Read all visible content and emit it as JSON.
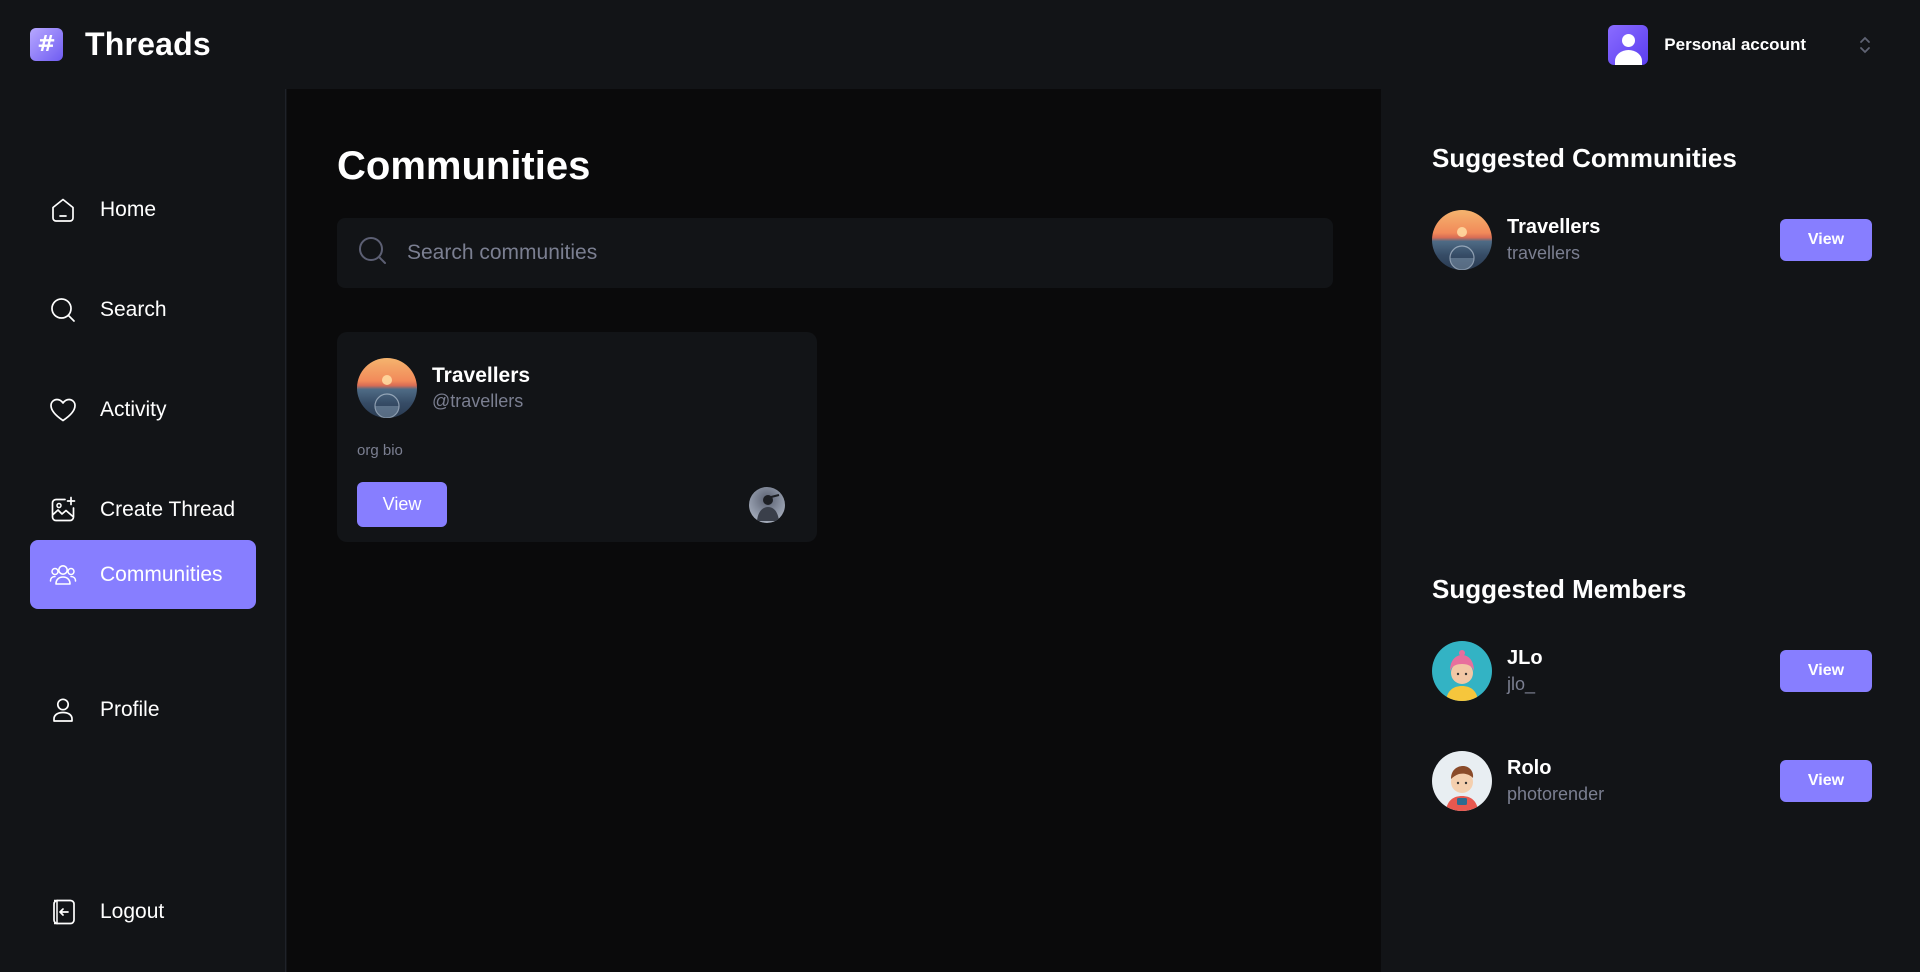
{
  "topbar": {
    "logo_glyph": "#",
    "brand": "Threads",
    "account_label": "Personal account"
  },
  "sidebar": {
    "items": [
      {
        "label": "Home",
        "icon": "home-icon"
      },
      {
        "label": "Search",
        "icon": "search-icon"
      },
      {
        "label": "Activity",
        "icon": "heart-icon"
      },
      {
        "label": "Create Thread",
        "icon": "image-plus-icon"
      },
      {
        "label": "Communities",
        "icon": "users-icon",
        "active": true
      },
      {
        "label": "Profile",
        "icon": "user-icon"
      }
    ],
    "logout": {
      "label": "Logout",
      "icon": "logout-icon"
    }
  },
  "main": {
    "title": "Communities",
    "search": {
      "placeholder": "Search communities",
      "value": ""
    },
    "community_card": {
      "name": "Travellers",
      "handle": "@travellers",
      "bio": "org bio",
      "view_label": "View"
    }
  },
  "right": {
    "communities_title": "Suggested Communities",
    "communities": [
      {
        "name": "Travellers",
        "handle": "travellers",
        "view_label": "View"
      }
    ],
    "members_title": "Suggested Members",
    "members": [
      {
        "name": "JLo",
        "handle": "jlo_",
        "view_label": "View"
      },
      {
        "name": "Rolo",
        "handle": "photorender",
        "view_label": "View"
      }
    ]
  },
  "colors": {
    "accent": "#877eff",
    "background": "#121417",
    "main_background": "#0a0a0b",
    "muted_text": "#7b7f91"
  }
}
